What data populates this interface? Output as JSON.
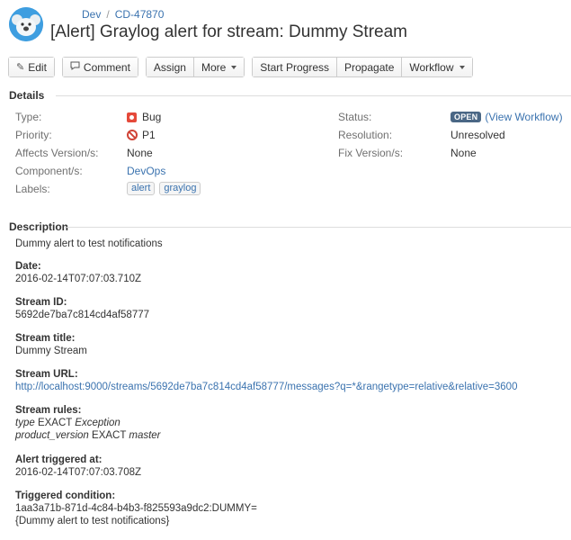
{
  "breadcrumb": {
    "project": "Dev",
    "issue_key": "CD-47870"
  },
  "issue": {
    "title": "[Alert] Graylog alert for stream: Dummy Stream"
  },
  "toolbar": {
    "edit": "Edit",
    "comment": "Comment",
    "assign": "Assign",
    "more": "More",
    "start_progress": "Start Progress",
    "propagate": "Propagate",
    "workflow": "Workflow"
  },
  "details": {
    "heading": "Details",
    "type_label": "Type:",
    "type_value": "Bug",
    "priority_label": "Priority:",
    "priority_value": "P1",
    "affects_label": "Affects Version/s:",
    "affects_value": "None",
    "component_label": "Component/s:",
    "component_value": "DevOps",
    "labels_label": "Labels:",
    "labels": [
      "alert",
      "graylog"
    ],
    "status_label": "Status:",
    "status_value": "OPEN",
    "view_workflow_open": "(",
    "view_workflow": "View Workflow",
    "view_workflow_close": ")",
    "resolution_label": "Resolution:",
    "resolution_value": "Unresolved",
    "fix_label": "Fix Version/s:",
    "fix_value": "None"
  },
  "description": {
    "heading": "Description",
    "intro": "Dummy alert to test notifications",
    "date_head": "Date:",
    "date_value": "2016-02-14T07:07:03.710Z",
    "stream_id_head": "Stream ID:",
    "stream_id_value": "5692de7ba7c814cd4af58777",
    "stream_title_head": "Stream title:",
    "stream_title_value": "Dummy Stream",
    "stream_url_head": "Stream URL:",
    "stream_url_value": "http://localhost:9000/streams/5692de7ba7c814cd4af58777/messages?q=*&rangetype=relative&relative=3600",
    "rules_head": "Stream rules:",
    "rule1_field": "type",
    "rule1_op": " EXACT ",
    "rule1_value": "Exception",
    "rule2_field": "product_version",
    "rule2_op": " EXACT ",
    "rule2_value": "master",
    "triggered_head": "Alert triggered at:",
    "triggered_value": "2016-02-14T07:07:03.708Z",
    "condition_head": "Triggered condition:",
    "condition_line1": "1aa3a71b-871d-4c84-b4b3-f825593a9dc2:DUMMY=",
    "condition_line2": "{Dummy alert to test notifications}"
  },
  "colors": {
    "link": "#3b73af",
    "status_lozenge": "#4a6785",
    "bug": "#e5493a",
    "priority": "#d04437"
  },
  "icons": {
    "avatar": "koala-avatar-icon",
    "edit": "pencil-icon",
    "comment": "comment-icon",
    "type": "bug-icon",
    "priority": "blocker-priority-icon"
  }
}
